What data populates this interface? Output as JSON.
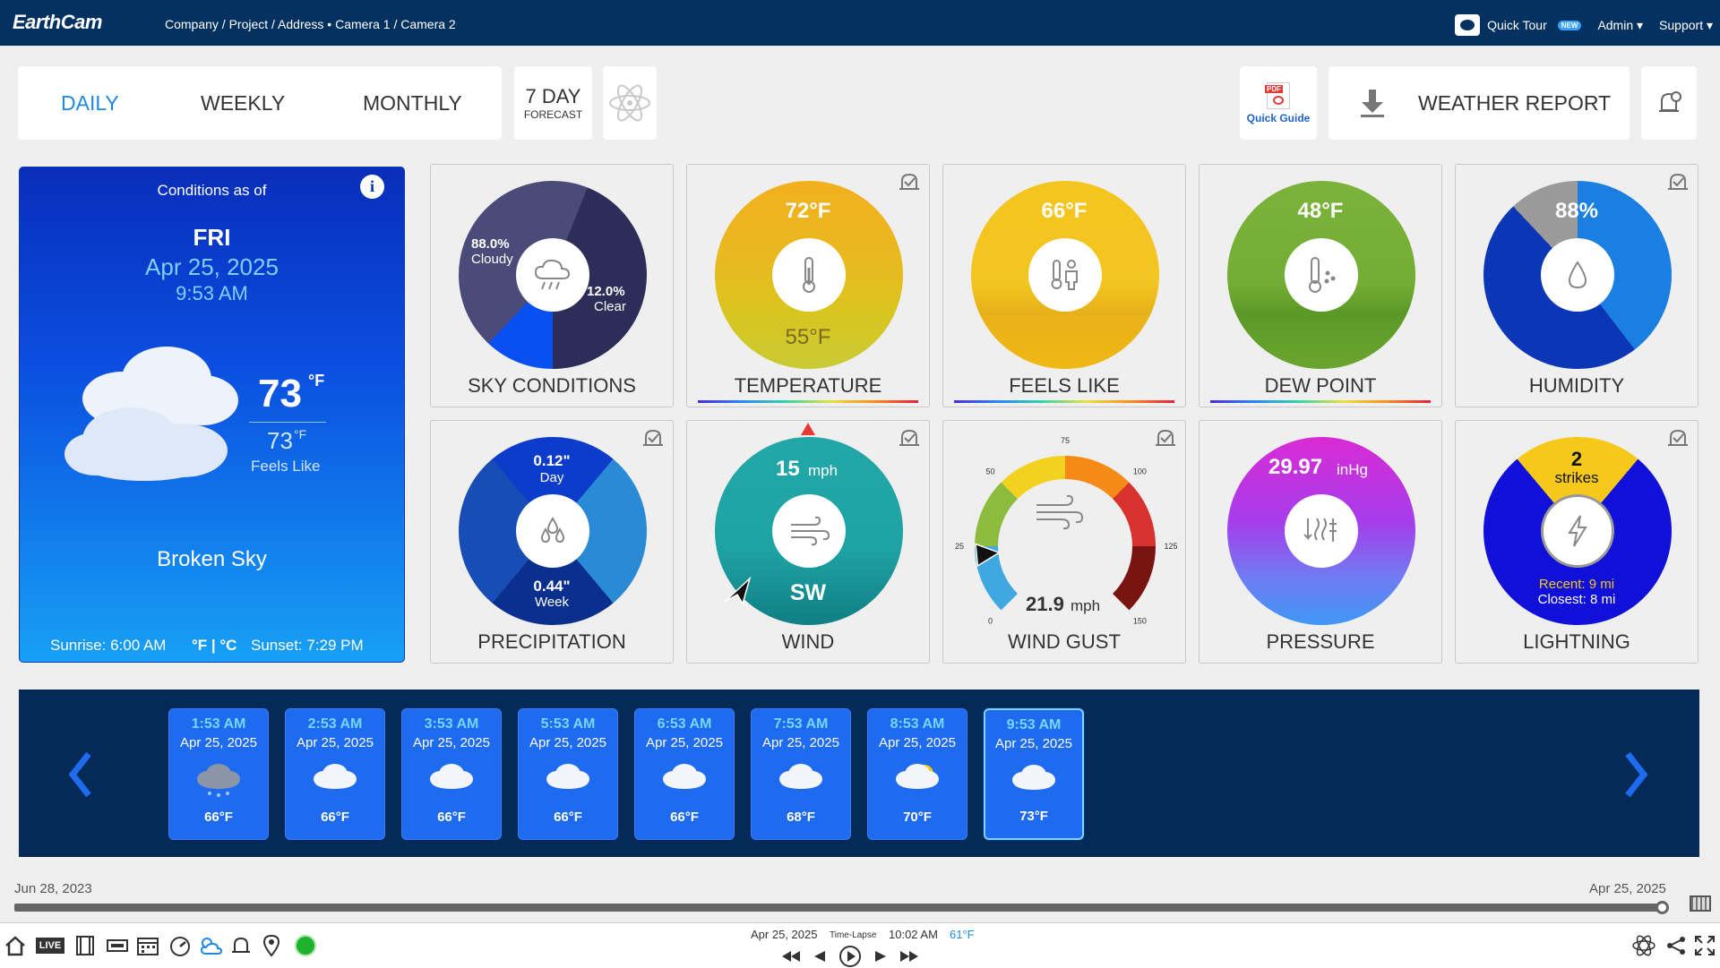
{
  "topbar": {
    "logo": "EarthCam",
    "breadcrumb": "Company / Project  / Address  •  Camera 1 / Camera 2",
    "quick_tour": "Quick Tour",
    "new_badge": "NEW",
    "admin": "Admin ▾",
    "support": "Support ▾"
  },
  "tabs": {
    "daily": "DAILY",
    "weekly": "WEEKLY",
    "monthly": "MONTHLY"
  },
  "forecast": {
    "big": "7 DAY",
    "small": "FORECAST"
  },
  "quick_guide": {
    "pdf": "PDF",
    "label": "Quick Guide"
  },
  "weather_report": "WEATHER REPORT",
  "conditions": {
    "title": "Conditions as of",
    "day": "FRI",
    "date": "Apr 25, 2025",
    "time": "9:53 AM",
    "temp": "73",
    "temp_unit": "°F",
    "feels_temp": "73",
    "feels_unit": "°F",
    "feels_label": "Feels Like",
    "description": "Broken Sky",
    "sunrise": "Sunrise: 6:00 AM",
    "unit_toggle": "°F | °C",
    "sunset": "Sunset: 7:29 PM"
  },
  "tiles": {
    "sky": {
      "label": "SKY CONDITIONS",
      "cloudy_pct": "88.0%",
      "cloudy": "Cloudy",
      "clear_pct": "12.0%",
      "clear": "Clear",
      "cloudy_value": 88
    },
    "temperature": {
      "label": "TEMPERATURE",
      "high": "72°F",
      "low": "55°F"
    },
    "feels": {
      "label": "FEELS LIKE",
      "value": "66°F"
    },
    "dew": {
      "label": "DEW POINT",
      "value": "48°F"
    },
    "humidity": {
      "label": "HUMIDITY",
      "value": "88%",
      "percent": 88
    },
    "precip": {
      "label": "PRECIPITATION",
      "day_val": "0.12\"",
      "day": "Day",
      "week_val": "0.44\"",
      "week": "Week"
    },
    "wind": {
      "label": "WIND",
      "speed": "15",
      "unit": "mph",
      "dir": "SW"
    },
    "gust": {
      "label": "WIND GUST",
      "value": "21.9",
      "unit": "mph",
      "ticks": [
        "0",
        "25",
        "50",
        "75",
        "100",
        "125",
        "150"
      ],
      "speed": 21.9,
      "max": 150
    },
    "pressure": {
      "label": "PRESSURE",
      "value": "29.97",
      "unit": "inHg"
    },
    "lightning": {
      "label": "LIGHTNING",
      "count": "2",
      "strikes": "strikes",
      "recent": "Recent: 9 mi",
      "closest": "Closest: 8 mi"
    }
  },
  "hourly": [
    {
      "time": "1:53 AM",
      "date": "Apr 25, 2025",
      "temp": "66°F",
      "icon": "rain-cloud-icon"
    },
    {
      "time": "2:53 AM",
      "date": "Apr 25, 2025",
      "temp": "66°F",
      "icon": "cloud-icon"
    },
    {
      "time": "3:53 AM",
      "date": "Apr 25, 2025",
      "temp": "66°F",
      "icon": "cloud-icon"
    },
    {
      "time": "5:53 AM",
      "date": "Apr 25, 2025",
      "temp": "66°F",
      "icon": "cloud-icon"
    },
    {
      "time": "6:53 AM",
      "date": "Apr 25, 2025",
      "temp": "66°F",
      "icon": "cloud-icon"
    },
    {
      "time": "7:53 AM",
      "date": "Apr 25, 2025",
      "temp": "68°F",
      "icon": "cloud-icon"
    },
    {
      "time": "8:53 AM",
      "date": "Apr 25, 2025",
      "temp": "70°F",
      "icon": "partly-sunny-icon"
    },
    {
      "time": "9:53 AM",
      "date": "Apr 25, 2025",
      "temp": "73°F",
      "icon": "cloud-icon"
    }
  ],
  "scrubber": {
    "start": "Jun 28, 2023",
    "end": "Apr 25, 2025"
  },
  "player": {
    "date": "Apr 25, 2025",
    "mode": "Time-Lapse",
    "time": "10:02 AM",
    "temp": "61°F",
    "live": "LIVE"
  }
}
